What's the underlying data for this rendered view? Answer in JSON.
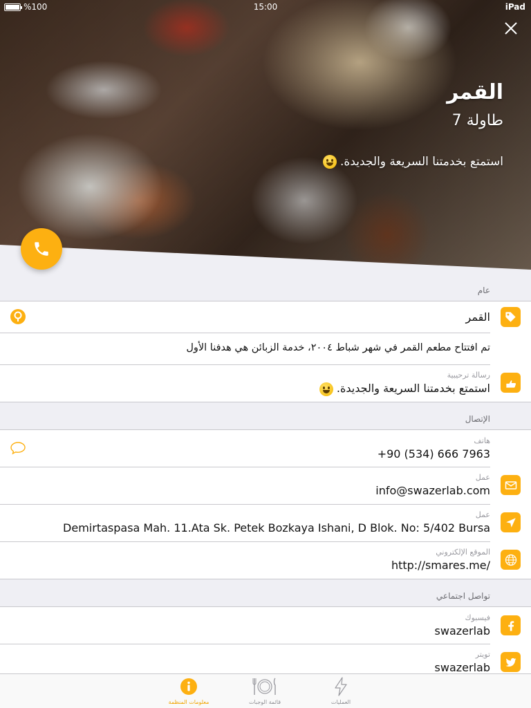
{
  "status_bar": {
    "battery": "%100",
    "time": "15:00",
    "device": "iPad"
  },
  "hero": {
    "title": "القمر",
    "subtitle": "طاولة 7",
    "message": "استمتع بخدمتنا السريعة والجديدة."
  },
  "icons": {
    "close": "close-icon",
    "phone": "phone-icon",
    "tag": "tag-icon",
    "pin": "map-pin-icon",
    "welcome": "hand-icon",
    "speech": "speech-bubble-icon",
    "mail": "mail-icon",
    "location": "location-arrow-icon",
    "globe": "globe-icon",
    "facebook": "facebook-icon",
    "twitter": "twitter-icon",
    "info": "info-icon",
    "menu": "plate-cutlery-icon",
    "ops": "lightning-icon"
  },
  "colors": {
    "accent": "#fdb011",
    "separator": "#c8c7cc",
    "background": "#efeff4"
  },
  "general": {
    "header": "عام",
    "name": "القمر",
    "description": "تم افتتاح مطعم القمر في شهر شباط ٢٠٠٤، خدمة الزبائن هي هدفنا الأول",
    "welcome_label": "رسالة ترحيبية",
    "welcome_value": "استمتع بخدمتنا السريعة والجديدة."
  },
  "contact": {
    "header": "الإتصال",
    "phone_label": "هاتف",
    "phone_value": "+90 (534) 666 7963",
    "email_label": "عمل",
    "email_value": "info@swazerlab.com",
    "address_label": "عمل",
    "address_value": "Demirtaspasa Mah. 11.Ata Sk. Petek Bozkaya Ishani, D Blok. No: 5/402 Bursa",
    "website_label": "الموقع الإلكتروني",
    "website_value": "http://smares.me/"
  },
  "social": {
    "header": "تواصل اجتماعي",
    "facebook_label": "فيسبوك",
    "facebook_value": "swazerlab",
    "twitter_label": "تويتر",
    "twitter_value": "swazerlab"
  },
  "tabs": [
    {
      "label": "معلومات المنظمة",
      "active": true
    },
    {
      "label": "قائمة الوجبات",
      "active": false
    },
    {
      "label": "العمليات",
      "active": false
    }
  ]
}
